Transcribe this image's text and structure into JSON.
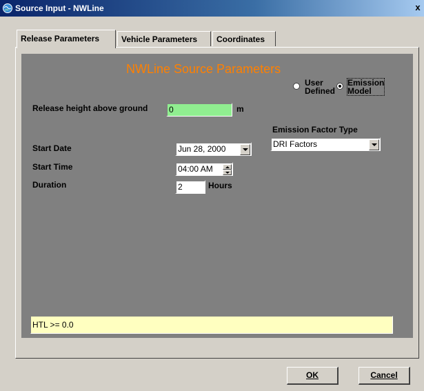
{
  "window": {
    "title": "Source Input - NWLine",
    "close_label": "x"
  },
  "tabs": [
    {
      "label": "Release Parameters",
      "active": true
    },
    {
      "label": "Vehicle Parameters",
      "active": false
    },
    {
      "label": "Coordinates",
      "active": false
    }
  ],
  "panel": {
    "title": "NWLine Source Parameters",
    "emission_mode": {
      "options": [
        {
          "line1": "User",
          "line2": "Defined",
          "selected": false
        },
        {
          "line1": "Emission",
          "line2": "Model",
          "selected": true
        }
      ]
    },
    "release_height": {
      "label": "Release height above ground",
      "value": "0",
      "unit": "m"
    },
    "emission_factor": {
      "label": "Emission Factor Type",
      "value": "DRI Factors"
    },
    "start_date": {
      "label": "Start Date",
      "value": "Jun 28, 2000"
    },
    "start_time": {
      "label": "Start Time",
      "value": "04:00 AM"
    },
    "duration": {
      "label": "Duration",
      "value": "2",
      "unit": "Hours"
    },
    "status_text": "HTL >= 0.0"
  },
  "buttons": {
    "ok": "OK",
    "cancel": "Cancel"
  },
  "colors": {
    "title_accent": "#ff8000",
    "height_field": "#90ee90",
    "status_box": "#ffffc0",
    "titlebar": "#0a246a"
  },
  "icons": {
    "app": "globe-icon",
    "close": "close-icon"
  }
}
